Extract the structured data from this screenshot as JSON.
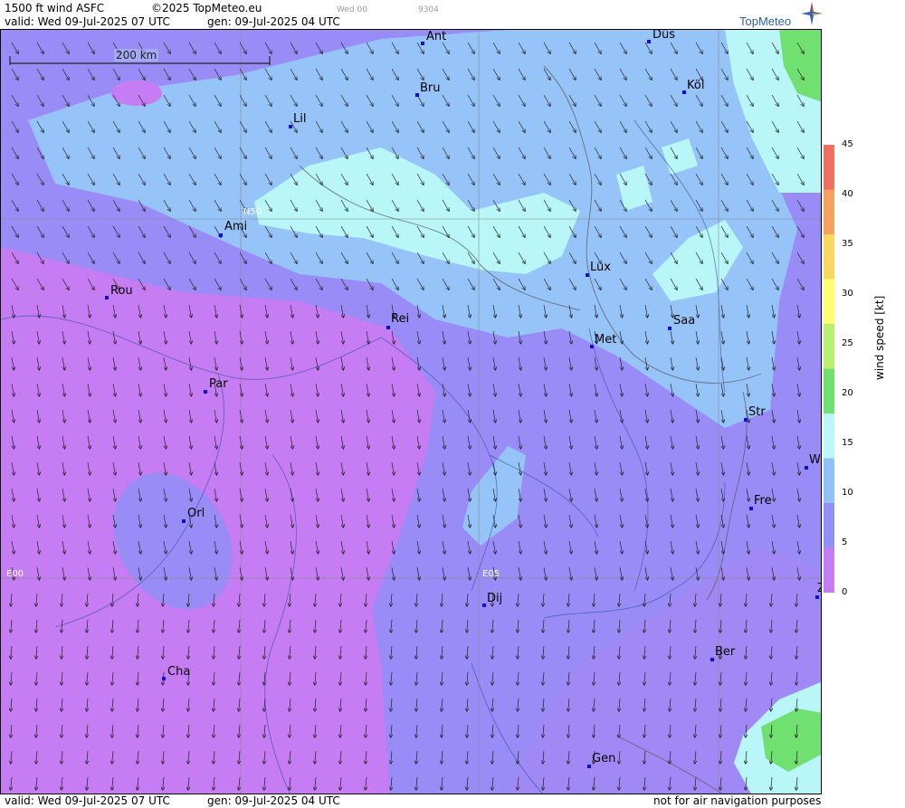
{
  "header": {
    "product": "1500 ft wind ASFC",
    "copyright": "©2025 TopMeteo.eu",
    "day_tag": "Wed 00",
    "run_tag": "9304",
    "valid": "valid:  Wed  09-Jul-2025  07 UTC",
    "gen": "gen: 09-Jul-2025 04 UTC",
    "brand": "TopMeteo"
  },
  "footer": {
    "valid": "valid:  Wed  09-Jul-2025  07 UTC",
    "gen": "gen: 09-Jul-2025 04 UTC",
    "disclaimer": "not for air navigation purposes"
  },
  "map": {
    "scale_bar_label": "200 km",
    "grid_labels": {
      "n50": "N50",
      "e00": "E00",
      "e05": "E05"
    },
    "cities": [
      {
        "id": "ant",
        "name": "Ant"
      },
      {
        "id": "dus",
        "name": "Düs"
      },
      {
        "id": "bru",
        "name": "Bru"
      },
      {
        "id": "kol",
        "name": "Köl"
      },
      {
        "id": "lil",
        "name": "Lil"
      },
      {
        "id": "ami",
        "name": "Ami"
      },
      {
        "id": "rou",
        "name": "Rou"
      },
      {
        "id": "lux",
        "name": "Lux"
      },
      {
        "id": "rei",
        "name": "Rei"
      },
      {
        "id": "saa",
        "name": "Saa"
      },
      {
        "id": "met",
        "name": "Met"
      },
      {
        "id": "par",
        "name": "Par"
      },
      {
        "id": "str",
        "name": "Str"
      },
      {
        "id": "w",
        "name": "W"
      },
      {
        "id": "fre",
        "name": "Fre"
      },
      {
        "id": "orl",
        "name": "Orl"
      },
      {
        "id": "dij",
        "name": "Dij"
      },
      {
        "id": "ber",
        "name": "Ber"
      },
      {
        "id": "cha",
        "name": "Cha"
      },
      {
        "id": "gen",
        "name": "Gen"
      },
      {
        "id": "z",
        "name": "Z"
      }
    ],
    "wind_direction": "north-westerly (arrows pointing south-east to south)"
  },
  "legend": {
    "title": "wind speed [kt]",
    "ticks": [
      "45",
      "40",
      "35",
      "30",
      "25",
      "20",
      "15",
      "10",
      "5",
      "0"
    ],
    "colors": [
      "#f07060",
      "#f8a060",
      "#f8d860",
      "#ffff70",
      "#b8f070",
      "#70e070",
      "#b8f8f8",
      "#90c0f8",
      "#9090f8",
      "#c67cf2"
    ]
  }
}
